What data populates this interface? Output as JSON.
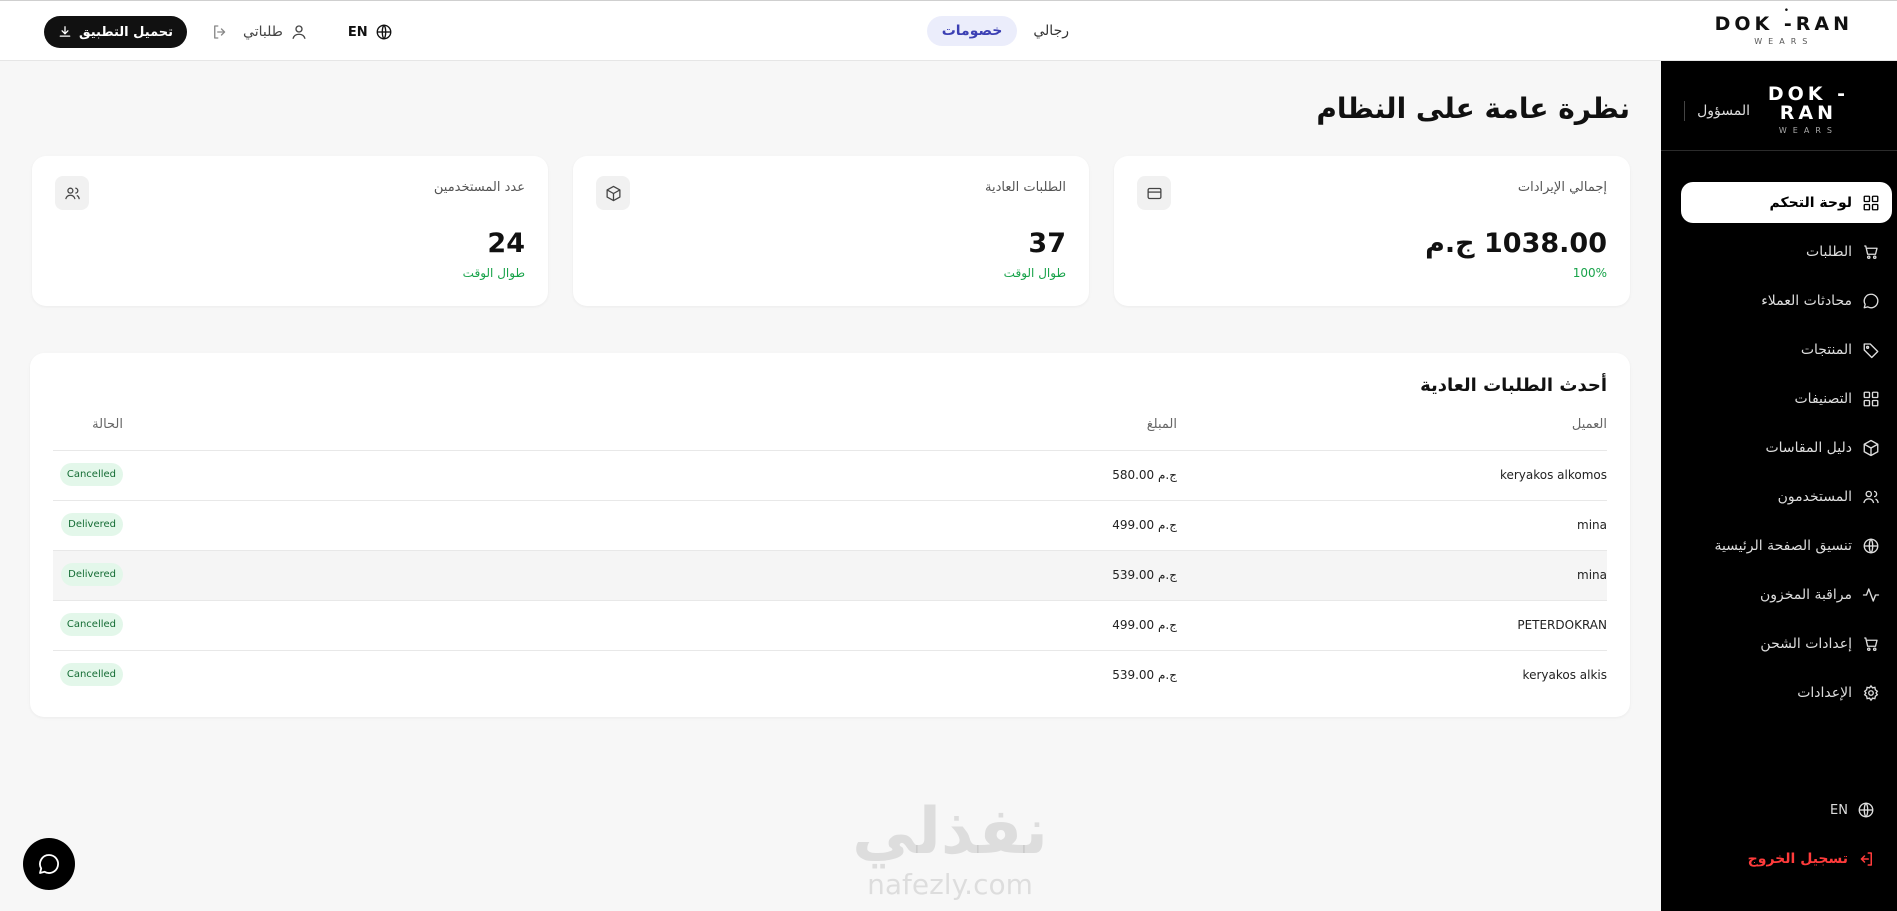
{
  "brand": {
    "logo_mark": "DOK -RAN",
    "logo_sub": "WEARS",
    "side_logo_line1": "DOK -",
    "side_logo_line2": "RAN"
  },
  "header": {
    "nav": [
      {
        "label": "رجالي"
      },
      {
        "label": "خصومات"
      }
    ],
    "my_orders": "طلباتي",
    "lang": "EN",
    "download_button": "تحميل التطبيق"
  },
  "sidebar": {
    "role": "المسؤول",
    "items": [
      {
        "label": "لوحة التحكم",
        "icon": "dashboard-icon"
      },
      {
        "label": "الطلبات",
        "icon": "cart-icon"
      },
      {
        "label": "محادثات العملاء",
        "icon": "chat-bubble-icon"
      },
      {
        "label": "المنتجات",
        "icon": "tag-icon"
      },
      {
        "label": "التصنيفات",
        "icon": "grid-icon"
      },
      {
        "label": "دليل المقاسات",
        "icon": "box-icon"
      },
      {
        "label": "المستخدمون",
        "icon": "users-icon"
      },
      {
        "label": "تنسيق الصفحة الرئيسية",
        "icon": "globe-icon"
      },
      {
        "label": "مراقبة المخزون",
        "icon": "activity-icon"
      },
      {
        "label": "إعدادات الشحن",
        "icon": "cart-icon"
      },
      {
        "label": "الإعدادات",
        "icon": "gear-icon"
      }
    ],
    "lang": "EN",
    "logout": "تسجيل الخروج"
  },
  "main": {
    "title": "نظرة عامة على النظام",
    "cards": [
      {
        "label": "إجمالي الإيرادات",
        "value": "1038.00 ج.م",
        "sub": "100%",
        "icon": "credit-card-icon"
      },
      {
        "label": "الطلبات العادية",
        "value": "37",
        "sub": "طوال الوقت",
        "icon": "box-icon"
      },
      {
        "label": "عدد المستخدمين",
        "value": "24",
        "sub": "طوال الوقت",
        "icon": "users-icon"
      }
    ],
    "orders": {
      "title": "أحدث الطلبات العادية",
      "columns": {
        "customer": "العميل",
        "amount": "المبلغ",
        "status": "الحالة"
      },
      "rows": [
        {
          "customer": "keryakos alkomos",
          "amount": "580.00 ج.م",
          "status": "Cancelled"
        },
        {
          "customer": "mina",
          "amount": "499.00 ج.م",
          "status": "Delivered"
        },
        {
          "customer": "mina",
          "amount": "539.00 ج.م",
          "status": "Delivered"
        },
        {
          "customer": "PETERDOKRAN",
          "amount": "499.00 ج.م",
          "status": "Cancelled"
        },
        {
          "customer": "keryakos alkis",
          "amount": "539.00 ج.م",
          "status": "Cancelled"
        }
      ]
    }
  },
  "watermark": {
    "ar": "نفذلي",
    "en": "nafezly.com"
  },
  "colors": {
    "accent": "#3b3fb3",
    "success": "#18a34a",
    "danger": "#ff3b3b",
    "sidebar_bg": "#000000"
  }
}
